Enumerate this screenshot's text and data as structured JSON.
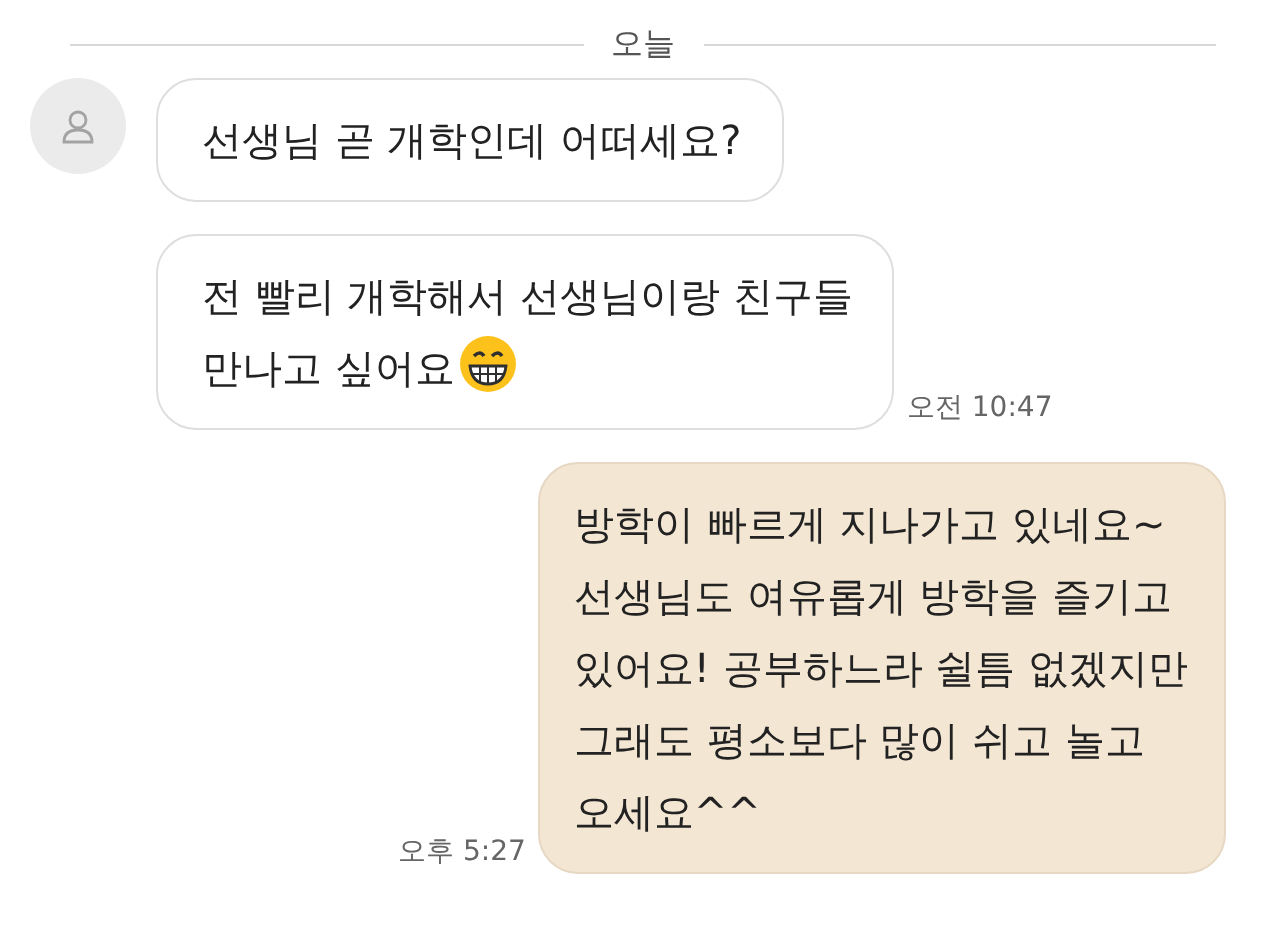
{
  "date_divider": "오늘",
  "messages": [
    {
      "kind": "incoming",
      "show_avatar": true,
      "text": "선생님 곧 개학인데 어떠세요?"
    },
    {
      "kind": "incoming",
      "show_avatar": false,
      "text": "전 빨리 개학해서 선생님이랑 친구들\n만나고 싶어요",
      "emoji": true,
      "time": "오전 10:47"
    },
    {
      "kind": "outgoing",
      "text": "방학이 빠르게 지나가고 있네요~\n선생님도 여유롭게 방학을 즐기고\n있어요! 공부하느라 쉴틈 없겠지만\n그래도 평소보다 많이 쉬고 놀고\n오세요^^",
      "time": "오후 5:27"
    }
  ]
}
